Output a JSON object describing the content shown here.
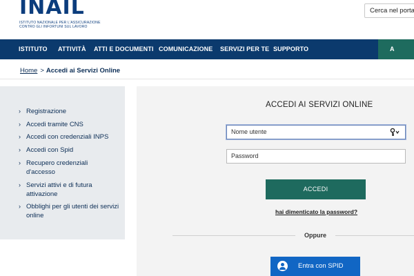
{
  "header": {
    "logo_text": "INAIL",
    "logo_subtitle_line1": "ISTITUTO NAZIONALE PER L'ASSICURAZIONE",
    "logo_subtitle_line2": "CONTRO GLI INFORTUNI SUL LAVORO",
    "search_placeholder": "Cerca nel portale"
  },
  "nav": {
    "items": [
      "ISTITUTO",
      "ATTIVITÀ",
      "ATTI E DOCUMENTI",
      "COMUNICAZIONE",
      "SERVIZI PER TE",
      "SUPPORTO"
    ],
    "accent_label": "A",
    "accent_color": "#1e6b5e",
    "bar_color": "#0b3a6d"
  },
  "breadcrumb": {
    "home": "Home",
    "separator": ">",
    "current": "Accedi ai Servizi Online"
  },
  "sidebar": {
    "items": [
      {
        "label": "Registrazione"
      },
      {
        "label": "Accedi tramite CNS"
      },
      {
        "label": "Accedi con credenziali INPS"
      },
      {
        "label": "Accedi con Spid"
      },
      {
        "label": "Recupero credenziali d'accesso"
      },
      {
        "label": "Servizi attivi e di futura attivazione"
      },
      {
        "label": "Obblighi per gli utenti dei servizi online"
      }
    ]
  },
  "login": {
    "title": "ACCEDI AI SERVIZI ONLINE",
    "username_placeholder": "Nome utente",
    "password_placeholder": "Password",
    "submit_label": "ACCEDI",
    "forgot_password": "hai dimenticato la password?",
    "divider_text": "Oppure",
    "spid_label": "Entra con SPID",
    "submit_color": "#1e6a5e",
    "spid_color": "#1166c4"
  }
}
